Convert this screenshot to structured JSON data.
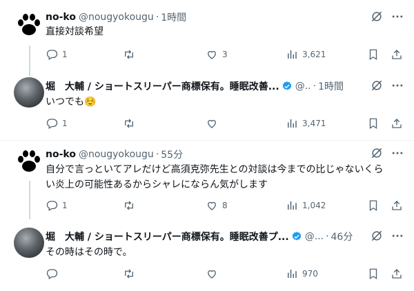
{
  "tweets": [
    {
      "name": "no-ko",
      "handle": "@nougyokougu",
      "dot": "·",
      "time": "1時間",
      "text": "直接対談希望",
      "replies": "1",
      "retweets": "",
      "likes": "3",
      "views": "3,621",
      "avatar": "paw-icon",
      "verified": false
    },
    {
      "name": "堀　大輔 / ショートスリーパー商標保有。睡眠改善...",
      "handle": "@..",
      "dot": "·",
      "time": "1時間",
      "text": "いつでも☺️",
      "replies": "1",
      "retweets": "",
      "likes": "",
      "views": "3,471",
      "avatar": "photo",
      "verified": true
    },
    {
      "name": "no-ko",
      "handle": "@nougyokougu",
      "dot": "·",
      "time": "55分",
      "text": "自分で言っといてアレだけど高須克弥先生との対談は今までの比じゃないくらい炎上の可能性あるからシャレにならん気がします",
      "replies": "1",
      "retweets": "",
      "likes": "8",
      "views": "1,042",
      "avatar": "paw-icon",
      "verified": false
    },
    {
      "name": "堀　大輔 / ショートスリーパー商標保有。睡眠改善プ...",
      "handle": "@...",
      "dot": "·",
      "time": "46分",
      "text": "その時はその時で。",
      "replies": "",
      "retweets": "",
      "likes": "",
      "views": "970",
      "avatar": "photo",
      "verified": true
    }
  ],
  "colors": {
    "text": "#0f1419",
    "muted": "#536471",
    "verified": "#1d9bf0",
    "divider": "#eff3f4",
    "thread": "#cfd9de"
  }
}
